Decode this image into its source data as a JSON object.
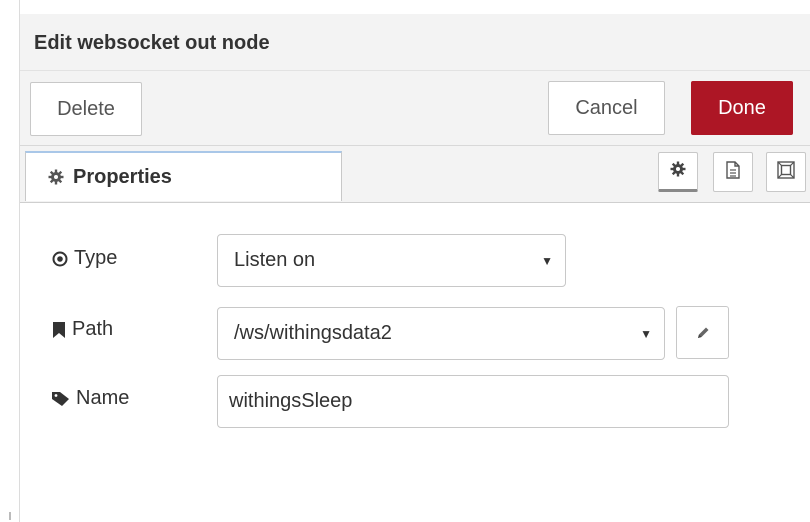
{
  "tray": {
    "title": "Edit websocket out node"
  },
  "toolbar": {
    "delete_label": "Delete",
    "cancel_label": "Cancel",
    "done_label": "Done",
    "done_color": "#ad1625"
  },
  "tabs": {
    "properties_label": "Properties",
    "icons": [
      "gear-icon",
      "description-icon",
      "appearance-icon"
    ]
  },
  "form": {
    "type": {
      "label": "Type",
      "value": "Listen on"
    },
    "path": {
      "label": "Path",
      "value": "/ws/withingsdata2"
    },
    "name": {
      "label": "Name",
      "value": "withingsSleep"
    }
  }
}
